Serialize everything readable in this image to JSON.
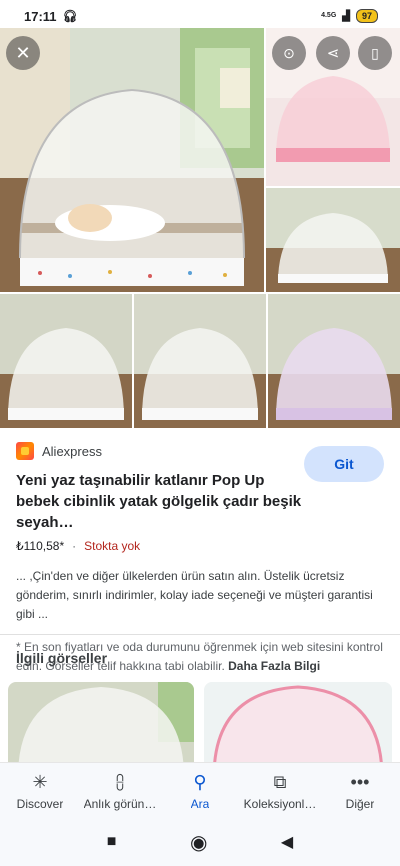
{
  "status_bar": {
    "time": "17:11",
    "network": "4.5G",
    "battery": "97"
  },
  "overlay": {
    "close_icon": "close-icon",
    "lens_icon": "lens-icon",
    "share_icon": "share-icon",
    "save_icon": "bookmark-icon"
  },
  "result": {
    "source": "Aliexpress",
    "go_label": "Git",
    "title": "Yeni yaz taşınabilir katlanır Pop Up bebek cibinlik yatak gölgelik çadır beşik seyah…",
    "price": "₺110,58*",
    "separator": "·",
    "stock": "Stokta yok",
    "description": "... ,Çin'den ve diğer ülkelerden ürün satın alın. Üstelik ücretsiz gönderim, sınırlı indirimler, kolay iade seçeneği ve müşteri garantisi gibi ...",
    "notice": "* En son fiyatları ve oda durumunu öğrenmek için web sitesini kontrol edin. Görseller telif hakkına tabi olabilir.",
    "more_link": "Daha Fazla Bilgi"
  },
  "related": {
    "title": "İlgili görseller"
  },
  "bottom_nav": [
    {
      "label": "Discover",
      "icon": "asterisk-icon"
    },
    {
      "label": "Anlık görün…",
      "icon": "updates-icon"
    },
    {
      "label": "Ara",
      "icon": "search-icon"
    },
    {
      "label": "Koleksiyonl…",
      "icon": "collections-icon"
    },
    {
      "label": "Diğer",
      "icon": "more-icon"
    }
  ],
  "colors": {
    "accent": "#0b57d0",
    "go_button_bg": "#d3e3fd",
    "stock_red": "#b3261e"
  }
}
